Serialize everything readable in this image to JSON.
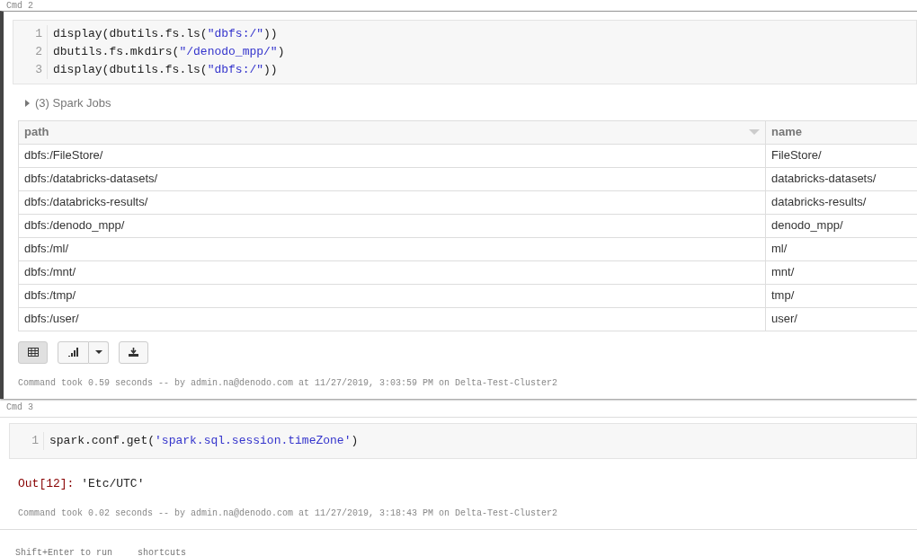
{
  "cells": [
    {
      "label": "Cmd 2",
      "active": true,
      "code": [
        [
          {
            "kind": "plain",
            "text": "display(dbutils.fs.ls("
          },
          {
            "kind": "string",
            "text": "\"dbfs:/\""
          },
          {
            "kind": "plain",
            "text": "))"
          }
        ],
        [
          {
            "kind": "plain",
            "text": "dbutils.fs.mkdirs("
          },
          {
            "kind": "string",
            "text": "\"/denodo_mpp/\""
          },
          {
            "kind": "plain",
            "text": ")"
          }
        ],
        [
          {
            "kind": "plain",
            "text": "display(dbutils.fs.ls("
          },
          {
            "kind": "string",
            "text": "\"dbfs:/\""
          },
          {
            "kind": "plain",
            "text": "))"
          }
        ]
      ],
      "line_numbers": [
        "1",
        "2",
        "3"
      ],
      "spark_jobs": "(3) Spark Jobs",
      "table": {
        "columns": [
          "path",
          "name"
        ],
        "rows": [
          [
            "dbfs:/FileStore/",
            "FileStore/"
          ],
          [
            "dbfs:/databricks-datasets/",
            "databricks-datasets/"
          ],
          [
            "dbfs:/databricks-results/",
            "databricks-results/"
          ],
          [
            "dbfs:/denodo_mpp/",
            "denodo_mpp/"
          ],
          [
            "dbfs:/ml/",
            "ml/"
          ],
          [
            "dbfs:/mnt/",
            "mnt/"
          ],
          [
            "dbfs:/tmp/",
            "tmp/"
          ],
          [
            "dbfs:/user/",
            "user/"
          ]
        ]
      },
      "view_buttons": [
        {
          "kind": "table",
          "selected": true
        },
        {
          "kind": "chart",
          "selected": false
        }
      ],
      "status": "Command took 0.59 seconds -- by admin.na@denodo.com at 11/27/2019, 3:03:59 PM on Delta-Test-Cluster2"
    },
    {
      "label": "Cmd 3",
      "active": false,
      "code": [
        [
          {
            "kind": "plain",
            "text": "spark.conf.get("
          },
          {
            "kind": "string",
            "text": "'spark.sql.session.timeZone'"
          },
          {
            "kind": "plain",
            "text": ")"
          }
        ]
      ],
      "line_numbers": [
        "1"
      ],
      "output": {
        "prompt": "Out[12]:",
        "value": "'Etc/UTC'"
      },
      "status": "Command took 0.02 seconds -- by admin.na@denodo.com at 11/27/2019, 3:18:43 PM on Delta-Test-Cluster2"
    }
  ],
  "footer": {
    "hint": "Shift+Enter to run",
    "link": "shortcuts"
  }
}
